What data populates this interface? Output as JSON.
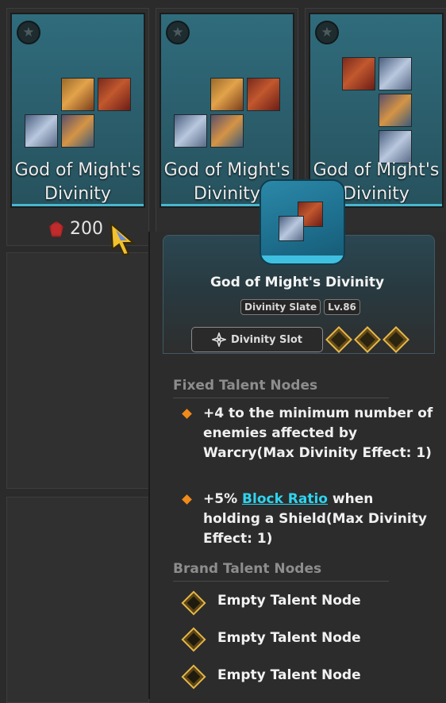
{
  "cards": [
    {
      "name": "God of Might's Divinity"
    },
    {
      "name": "God of Might's Divinity"
    },
    {
      "name": "God of Might's Divinity"
    }
  ],
  "price": {
    "amount": "200",
    "currency_icon": "red-crystal-icon"
  },
  "tooltip": {
    "title": "God of Might's Divinity",
    "tags": [
      "Divinity Slate",
      "Lv.86"
    ],
    "slot_label": "Divinity Slot",
    "fixed_header": "Fixed Talent Nodes",
    "fixed_nodes": [
      {
        "text": "+4 to the minimum number of enemies affected by Warcry(Max Divinity Effect: 1)"
      },
      {
        "prefix": "+5% ",
        "link": "Block Ratio",
        "suffix": " when holding a Shield(Max Divinity Effect: 1)"
      }
    ],
    "brand_header": "Brand Talent Nodes",
    "brand_nodes": [
      "Empty Talent Node",
      "Empty Talent Node",
      "Empty Talent Node"
    ]
  },
  "colors": {
    "accent": "#2fd4f0",
    "bullet": "#f08a1a",
    "slot_gold": "#e6b84a",
    "card_teal": "#2f6c7c"
  }
}
